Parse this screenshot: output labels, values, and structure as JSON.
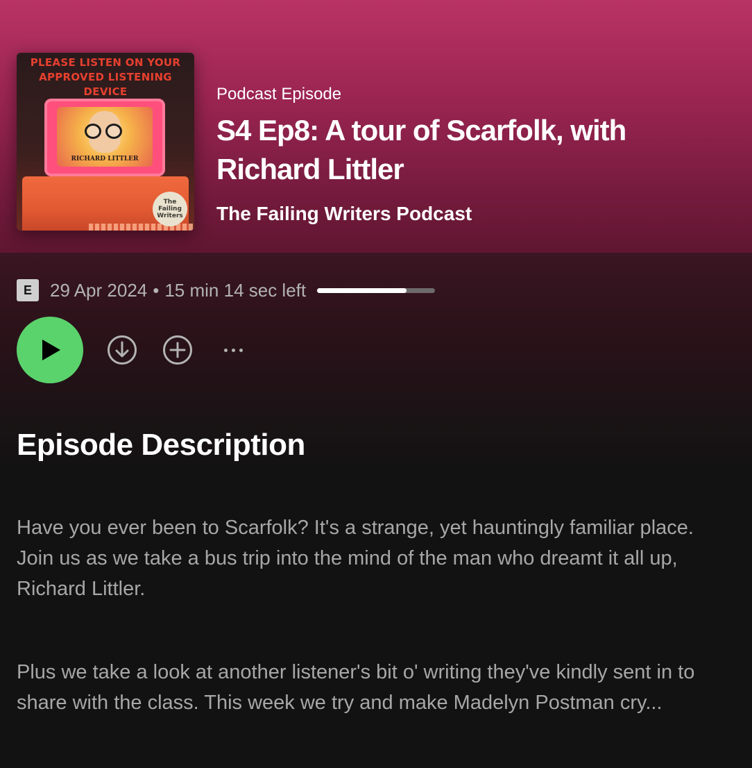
{
  "colors": {
    "header_top": "#b93365",
    "header_bottom": "#5f1630",
    "background": "#121212",
    "accent_play": "#5bd36c",
    "text_primary": "#ffffff",
    "text_secondary": "#a7a7a7"
  },
  "cover": {
    "banner": "PLEASE LISTEN ON YOUR APPROVED LISTENING DEVICE",
    "monitor_name": "RICHARD LITTLER",
    "badge": "The Failing Writers"
  },
  "header": {
    "episode_type": "Podcast Episode",
    "title": "S4 Ep8: A tour of Scarfolk, with Richard Littler",
    "show_name": "The Failing Writers Podcast"
  },
  "meta": {
    "explicit_badge": "E",
    "date": "29 Apr 2024",
    "separator": "•",
    "time_left": "15 min 14 sec left",
    "progress_fraction": 0.76
  },
  "controls": {
    "play_icon": "play-icon",
    "download_icon": "download-icon",
    "add_icon": "add-icon",
    "more_icon": "more-options-icon"
  },
  "description": {
    "heading": "Episode Description",
    "paragraphs": [
      "Have you ever been to Scarfolk? It's a strange, yet hauntingly familiar place. Join us as we take a bus trip into the mind of the man who dreamt it all up, Richard Littler.",
      "Plus we take a look at another listener's bit o' writing they've kindly sent in to share with the class. This week we try and make Madelyn Postman cry..."
    ]
  }
}
